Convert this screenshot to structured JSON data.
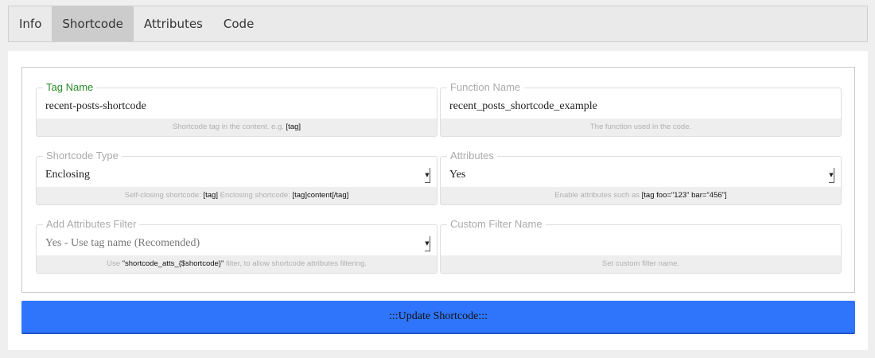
{
  "tabs": [
    {
      "label": "Info",
      "active": false
    },
    {
      "label": "Shortcode",
      "active": true
    },
    {
      "label": "Attributes",
      "active": false
    },
    {
      "label": "Code",
      "active": false
    }
  ],
  "fields": {
    "tag_name": {
      "legend": "Tag Name",
      "value": "recent-posts-shortcode",
      "hint_text": "Shortcode tag in the content. e.g.",
      "hint_code": "[tag]"
    },
    "function_name": {
      "legend": "Function Name",
      "value": "recent_posts_shortcode_example",
      "hint_text": "The function used in the code."
    },
    "shortcode_type": {
      "legend": "Shortcode Type",
      "value": "Enclosing",
      "hint_text_1": "Self-closing shortcode:",
      "hint_code_1": "[tag]",
      "hint_text_2": "Enclosing shortcode:",
      "hint_code_2": "[tag]content[/tag]"
    },
    "attributes": {
      "legend": "Attributes",
      "value": "Yes",
      "hint_text": "Enable attributes such as",
      "hint_code": "[tag foo=\"123\" bar=\"456\"]"
    },
    "add_attributes_filter": {
      "legend": "Add Attributes Filter",
      "value": "Yes - Use tag name (Recomended)",
      "hint_text_1": "Use",
      "hint_code": "\"shortcode_atts_{$shortcode}\"",
      "hint_text_2": "filter, to allow shortcode attributes filtering."
    },
    "custom_filter_name": {
      "legend": "Custom Filter Name",
      "value": "",
      "hint_text": "Set custom filter name."
    }
  },
  "update_button": {
    "label": ":::Update Shortcode:::"
  },
  "colors": {
    "accent_button": "#2f75fb",
    "active_legend": "#2a8a2a",
    "active_tab": "#cccccc"
  }
}
